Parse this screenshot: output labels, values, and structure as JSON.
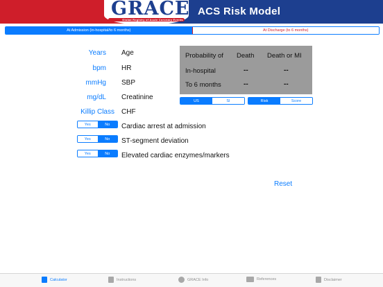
{
  "header": {
    "logo_text": "GRACE",
    "logo_subtitle": "Global Registry of Acute Coronary Events",
    "title": "ACS Risk Model"
  },
  "mode_tabs": [
    {
      "label": "At Admission (in-hospital/to 6 months)",
      "selected": true
    },
    {
      "label": "At Discharge (to 6 months)",
      "selected": false
    }
  ],
  "fields": [
    {
      "unit": "Years",
      "label": "Age"
    },
    {
      "unit": "bpm",
      "label": "HR"
    },
    {
      "unit": "mmHg",
      "label": "SBP"
    },
    {
      "unit": "mg/dL",
      "label": "Creatinine"
    },
    {
      "unit": "Killip Class",
      "label": "CHF"
    }
  ],
  "toggles": [
    {
      "yes": "Yes",
      "no": "No",
      "selected": "No",
      "label": "Cardiac arrest at admission"
    },
    {
      "yes": "Yes",
      "no": "No",
      "selected": "No",
      "label": "ST-segment deviation"
    },
    {
      "yes": "Yes",
      "no": "No",
      "selected": "No",
      "label": "Elevated cardiac enzymes/markers"
    }
  ],
  "results": {
    "header": [
      "Probability of",
      "Death",
      "Death or MI"
    ],
    "rows": [
      {
        "label": "In-hospital",
        "death": "--",
        "death_or_mi": "--"
      },
      {
        "label": "To 6 months",
        "death": "--",
        "death_or_mi": "--"
      }
    ]
  },
  "units_toggle": {
    "options": [
      "US",
      "SI"
    ],
    "selected": "US"
  },
  "output_toggle": {
    "options": [
      "Risk",
      "Score"
    ],
    "selected": "Risk"
  },
  "reset_label": "Reset",
  "tabbar": [
    {
      "label": "Calculator",
      "icon": "calculator-icon",
      "active": true
    },
    {
      "label": "Instructions",
      "icon": "document-icon",
      "active": false
    },
    {
      "label": "GRACE Info",
      "icon": "info-icon",
      "active": false
    },
    {
      "label": "References",
      "icon": "book-icon",
      "active": false
    },
    {
      "label": "Disclaimer",
      "icon": "page-icon",
      "active": false
    }
  ],
  "colors": {
    "accent": "#0a7cff",
    "brand_red": "#cf1e2a",
    "brand_blue": "#1d3f8f",
    "panel_gray": "#9b9b9b"
  }
}
